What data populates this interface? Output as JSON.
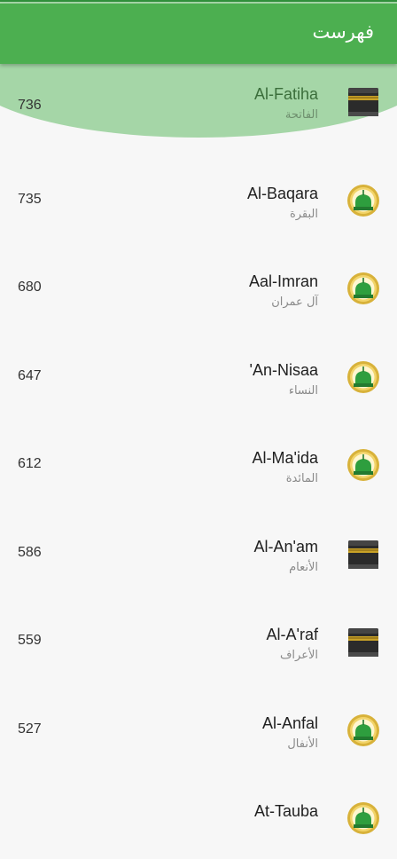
{
  "appbar": {
    "title": "فهرست"
  },
  "surahs": [
    {
      "name": "Al-Fatiha",
      "arabic": "الفاتحة",
      "count": "736",
      "icon": "kaaba-icon"
    },
    {
      "name": "Al-Baqara",
      "arabic": "البقرة",
      "count": "735",
      "icon": "medina-mosque-icon"
    },
    {
      "name": "Aal-Imran",
      "arabic": "آل عمران",
      "count": "680",
      "icon": "medina-mosque-icon"
    },
    {
      "name": "'An-Nisaa",
      "arabic": "النساء",
      "count": "647",
      "icon": "medina-mosque-icon"
    },
    {
      "name": "Al-Ma'ida",
      "arabic": "المائدة",
      "count": "612",
      "icon": "medina-mosque-icon"
    },
    {
      "name": "Al-An'am",
      "arabic": "الأنعام",
      "count": "586",
      "icon": "kaaba-icon"
    },
    {
      "name": "Al-A'raf",
      "arabic": "الأعراف",
      "count": "559",
      "icon": "kaaba-icon"
    },
    {
      "name": "Al-Anfal",
      "arabic": "الأنفال",
      "count": "527",
      "icon": "medina-mosque-icon"
    },
    {
      "name": "At-Tauba",
      "arabic": "",
      "count": "",
      "icon": "medina-mosque-icon"
    }
  ],
  "colors": {
    "appbar": "#4caf50",
    "selected": "#a5d6a7",
    "statusbar": "#2f8f3a"
  }
}
